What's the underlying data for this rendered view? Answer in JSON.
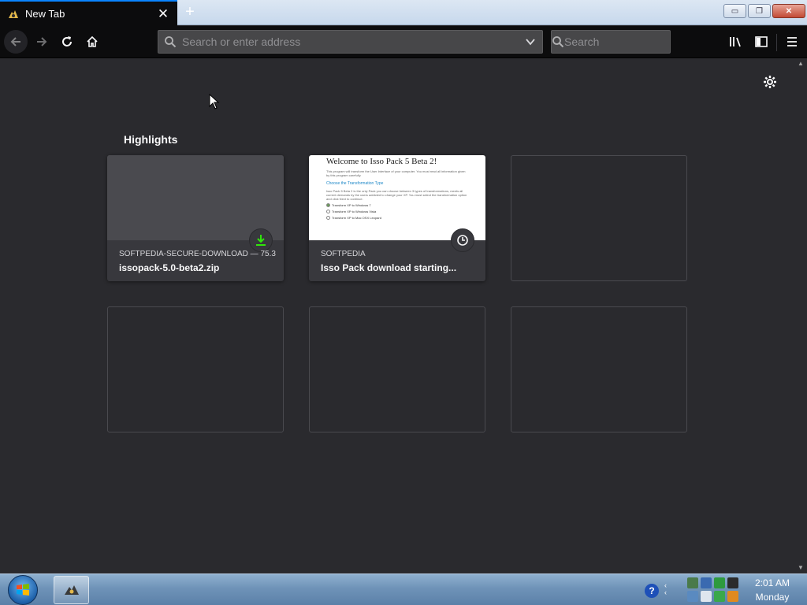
{
  "tab": {
    "title": "New Tab",
    "close_glyph": "✕",
    "favicon": "firefox-logo-icon"
  },
  "new_tab_glyph": "+",
  "window_controls": {
    "minimize": "▭",
    "maximize": "❐",
    "close": "✕"
  },
  "toolbar": {
    "url_placeholder": "Search or enter address",
    "search_placeholder": "Search"
  },
  "newtab": {
    "section_title": "Highlights",
    "highlights": [
      {
        "context": "SOFTPEDIA-SECURE-DOWNLOAD — 75.3 ...",
        "title": "issopack-5.0-beta2.zip",
        "badge": "download-icon"
      },
      {
        "context": "SOFTPEDIA",
        "title": "Isso Pack download starting...",
        "badge": "clock-icon"
      }
    ],
    "preview": {
      "heading": "Welcome to Isso Pack 5 Beta 2!",
      "intro": "This program will transform the User Interface of your computer. You must read all information given by this program carefully.",
      "subheading": "Choose the Transformation Type",
      "body": "Isso Pack 5 Beta 2 is the only Pack you can choose between 3 types of transformations, meets all current demands by the users addicted to change your XP. You must select the transformation option and click Next to continue.",
      "options": [
        "Transform XP to Windows 7",
        "Transform XP to Windows Vista",
        "Transform XP to Mac OSX Leopard"
      ]
    }
  },
  "taskbar": {
    "clock_time": "2:01 AM",
    "clock_day": "Monday",
    "help_glyph": "?"
  },
  "colors": {
    "accent": "#0a84ff",
    "content_bg": "#2a2a2e",
    "download_green": "#30e60b"
  }
}
